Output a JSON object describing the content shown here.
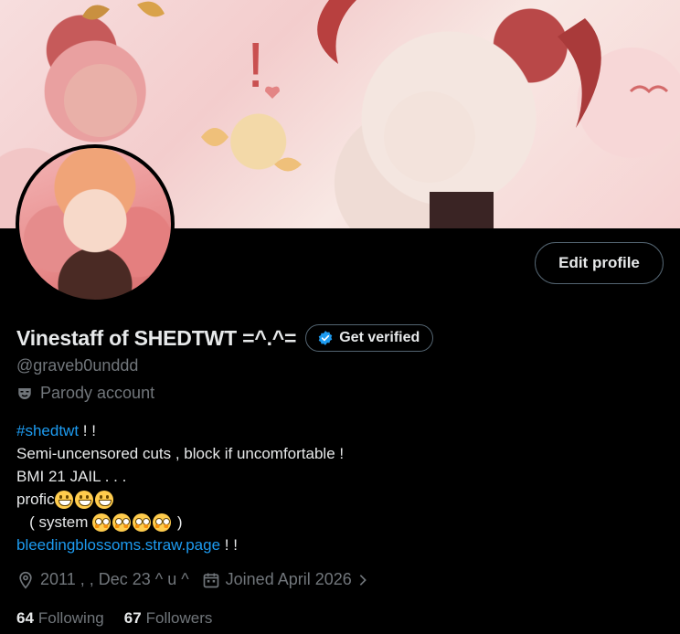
{
  "profile": {
    "display_name": "Vinestaff of SHEDTWT =^.^=",
    "handle": "@graveb0unddd",
    "account_label": "Parody account",
    "edit_button": "Edit profile",
    "verify_button": "Get verified"
  },
  "bio": {
    "hashtag": "#shedtwt",
    "line1_suffix": " ! !",
    "line2": "Semi-uncensored cuts , block if uncomfortable !",
    "line3": "BMI 21 JAIL . . .",
    "line4": "profic",
    "line5_prefix": "   ( system ",
    "line5_suffix": " )",
    "link": "bleedingblossoms.straw.page",
    "link_suffix": " ! !"
  },
  "meta": {
    "location": "2011 , , Dec 23 ^ u ^",
    "joined": "Joined April 2026"
  },
  "stats": {
    "following_count": "64",
    "following_label": "Following",
    "followers_count": "67",
    "followers_label": "Followers"
  },
  "colors": {
    "background": "#000000",
    "text": "#e7e9ea",
    "muted": "#71767b",
    "link": "#1d9bf0",
    "border": "#536471"
  },
  "icons": [
    "verified-badge-icon",
    "parody-mask-icon",
    "location-pin-icon",
    "calendar-icon",
    "chevron-right-icon",
    "grin-emoji-icon",
    "flushed-emoji-icon"
  ]
}
